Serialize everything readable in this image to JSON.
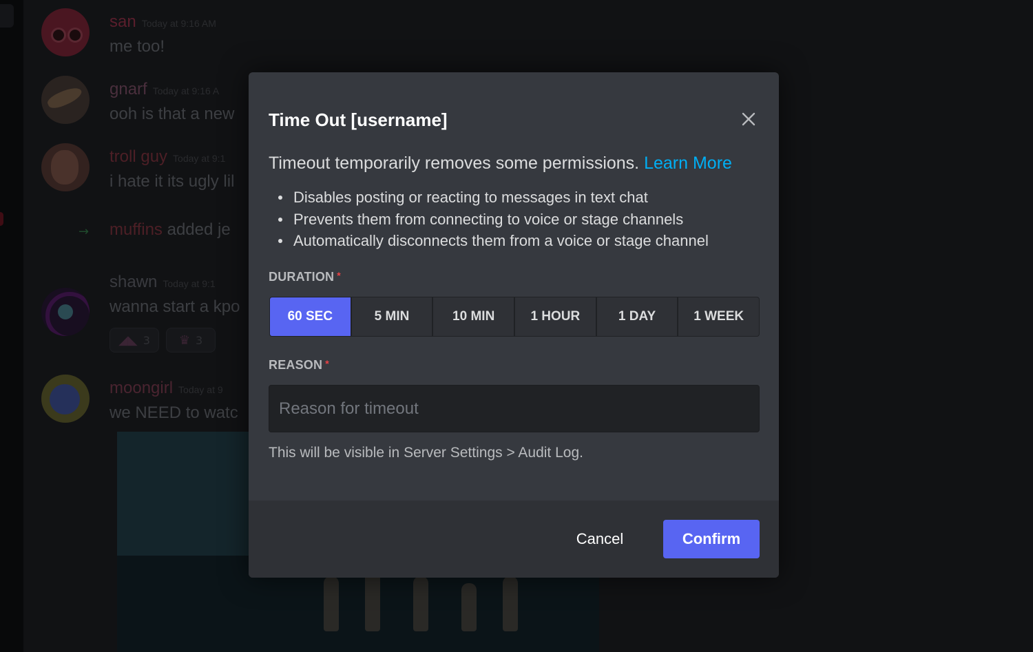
{
  "chat": {
    "messages": [
      {
        "username": "san",
        "timestamp": "Today at 9:16 AM",
        "text": "me too!",
        "name_color": "#5a1e2c"
      },
      {
        "username": "gnarf",
        "timestamp": "Today at 9:16 A",
        "text": "ooh is that a new",
        "name_color": "#4a2f3d"
      },
      {
        "username": "troll guy",
        "timestamp": "Today at 9:1",
        "text": "i hate it its ugly lil",
        "name_color": "#4d1f26"
      },
      {
        "username": "shawn",
        "timestamp": "Today at 9:1",
        "text": "wanna start a kpo",
        "name_color": "#3a3b40"
      },
      {
        "username": "moongirl",
        "timestamp": "Today at 9",
        "text": "we NEED to watc",
        "name_color": "#4a2430"
      }
    ],
    "system": {
      "username": "muffins",
      "text": " added je",
      "name_color": "#4d1f26"
    },
    "reactions": [
      {
        "count": "3"
      },
      {
        "count": "3"
      }
    ]
  },
  "modal": {
    "title": "Time Out [username]",
    "description": "Timeout temporarily removes some permissions.",
    "learn_more": "Learn More",
    "bullets": [
      "Disables posting or reacting to messages in text chat",
      "Prevents them from connecting to voice or stage channels",
      "Automatically disconnects them from a voice or stage channel"
    ],
    "duration_label": "DURATION",
    "required_mark": "*",
    "durations": [
      "60 SEC",
      "5 MIN",
      "10 MIN",
      "1 HOUR",
      "1 DAY",
      "1 WEEK"
    ],
    "selected_duration": "60 SEC",
    "reason_label": "REASON",
    "reason_placeholder": "Reason for timeout",
    "reason_value": "",
    "hint": "This will be visible in Server Settings > Audit Log.",
    "cancel_label": "Cancel",
    "confirm_label": "Confirm"
  },
  "colors": {
    "brand": "#5865f2",
    "link": "#00aff4",
    "required": "#ed4245",
    "modal_bg": "#36393f",
    "footer_bg": "#2f3136"
  },
  "icons": {
    "close": "close-icon",
    "reaction": "cat-emoji-icon"
  }
}
